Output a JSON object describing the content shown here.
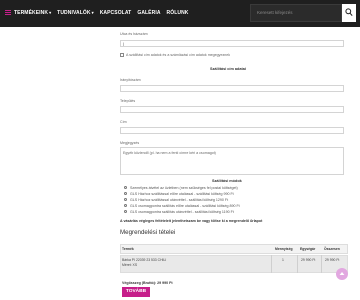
{
  "nav": {
    "items": [
      {
        "label": "TERMÉKEINK",
        "has_caret": true
      },
      {
        "label": "TUDNIVALÓK",
        "has_caret": true
      },
      {
        "label": "KAPCSOLAT",
        "has_caret": false
      },
      {
        "label": "GALÉRIA",
        "has_caret": false
      },
      {
        "label": "RÓLUNK",
        "has_caret": false
      }
    ],
    "search_placeholder": "Keresett kifejezés",
    "caret": "▾",
    "accent_color": "#c61e8a"
  },
  "form": {
    "top_field_label": "Utca és házszám",
    "top_field_value": "|",
    "checkbox_label": "A szállítási cím adatok és a számlázási cím adatok megegyeznek",
    "shipping_title": "Szállítási cím adatai",
    "fields": [
      {
        "label": "Irányítószám"
      },
      {
        "label": "Település"
      },
      {
        "label": "Cím"
      }
    ],
    "notes_label": "Megjegyzés",
    "notes_placeholder": "Egyéb közlendő (pl. ha nem a fenti címre kéri a csomagot)"
  },
  "shipping": {
    "title": "Szállítási módok",
    "options": [
      "Személyes átvétel az üzletben (nem szükséges fel postai költséget)",
      "GLS Házhoz szállítással előre utalással - szállítási költség 990 Ft",
      "GLS Házhoz szállítással utánvéttel - szállítási költség 1290 Ft",
      "GLS csomagpontra szállítás előre utalással - szállítási költség 890 Ft",
      "GLS csomagpontra szállítás utánvéttel - szállítási költség 1190 Ft"
    ],
    "terms_text": "A vásárlás végleges feltételeit jelenthetszam be vagy töltse ki a megrendelő űrlapot"
  },
  "order": {
    "title": "Megrendelési tételei",
    "columns": [
      "Termék",
      "Mennyiség",
      "Egységár",
      "Összesen"
    ],
    "rows": [
      {
        "product_line1": "Bárka PI 22039 23 533 CHILI",
        "product_line2": "Méret: XS",
        "quantity": "1",
        "unit_price": "29 990 Ft",
        "total": "29 990 Ft"
      }
    ],
    "sum_label": "Végösszeg (Bruttó): 29 990 Ft",
    "next_button": "TOVÁBB"
  }
}
